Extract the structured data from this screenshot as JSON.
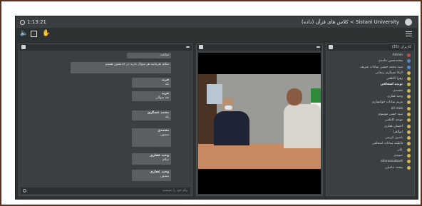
{
  "room": {
    "time": "1:13:21",
    "title": "Sistani University > کلاس های قرآن (داده)",
    "colors": {
      "frame": "#5b2e1d",
      "background": "#2e3132",
      "panel": "#3a3f42"
    }
  },
  "toolbar": {
    "icons": [
      "speaker-icon",
      "share-icon",
      "hand-icon",
      "menu-icon"
    ]
  },
  "chat": {
    "messages": [
      {
        "name": "",
        "text": "ساعت"
      },
      {
        "name": "",
        "text": "سلام بفرمایید هر سوال دارید در خدمتتون هستم"
      },
      {
        "name": "فرید",
        "text": "بله"
      },
      {
        "name": "فرید",
        "text": "چه سوالی"
      },
      {
        "name": "محمد عسگری",
        "text": "بله"
      },
      {
        "name": "محمدی",
        "text": "ممنون"
      },
      {
        "name": "وحید غفاری",
        "text": "سلام"
      },
      {
        "name": "وحید غفاری",
        "text": "ممنون"
      }
    ],
    "input_placeholder": "پیام خود را بنویسید"
  },
  "users": {
    "header": "کاربران (35)",
    "list": [
      {
        "name": "Admin",
        "type": "red",
        "bold": false
      },
      {
        "name": "محمدحسن حامدی",
        "type": "blue",
        "bold": false
      },
      {
        "name": "سید محمد حسین سادات شریف",
        "type": "blue",
        "bold": false
      },
      {
        "name": "الیکا عسگری زنجانی",
        "type": "yellow",
        "bold": false
      },
      {
        "name": "زهرا کاظمی",
        "type": "yellow",
        "bold": false
      },
      {
        "name": "نویده اسحاقی",
        "type": "yellow",
        "bold": true
      },
      {
        "name": "محمدی",
        "type": "yellow",
        "bold": false
      },
      {
        "name": "وحید غفاری",
        "type": "yellow",
        "bold": false
      },
      {
        "name": "مریم سادات خوانساری",
        "type": "yellow",
        "bold": false
      },
      {
        "name": "ali reza",
        "type": "yellow",
        "bold": false
      },
      {
        "name": "سید حسن موسوی",
        "type": "yellow",
        "bold": false
      },
      {
        "name": "مهدی کاظمی",
        "type": "yellow",
        "bold": false
      },
      {
        "name": "احسان غفاری",
        "type": "yellow",
        "bold": false
      },
      {
        "name": "ابوالفرا",
        "type": "yellow",
        "bold": false
      },
      {
        "name": "یاسین کریمی",
        "type": "yellow",
        "bold": false
      },
      {
        "name": "فاطمه سادات اسحاقی",
        "type": "yellow",
        "bold": false
      },
      {
        "name": "علی",
        "type": "yellow",
        "bold": false
      },
      {
        "name": "جمیدی",
        "type": "yellow",
        "bold": false
      },
      {
        "name": "aliarezsiabadi",
        "type": "yellow",
        "bold": false
      },
      {
        "name": "محمد حاجیان",
        "type": "yellow",
        "bold": false
      }
    ]
  }
}
